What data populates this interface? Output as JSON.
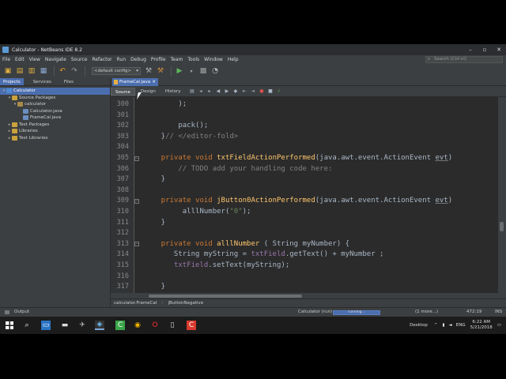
{
  "window": {
    "title": "Calculator - NetBeans IDE 8.2",
    "controls": [
      "–",
      "▫",
      "✕"
    ]
  },
  "menu": [
    "File",
    "Edit",
    "View",
    "Navigate",
    "Source",
    "Refactor",
    "Run",
    "Debug",
    "Profile",
    "Team",
    "Tools",
    "Window",
    "Help"
  ],
  "search": {
    "placeholder": "Search (Ctrl+I)"
  },
  "toolbar": {
    "config": "<default config>"
  },
  "left_panel": {
    "tabs": [
      "Projects",
      "Services",
      "Files"
    ],
    "active_tab": 0,
    "tree": [
      {
        "label": "Calculator",
        "depth": 0,
        "arrow": "▾",
        "icon": "proj",
        "selected": true
      },
      {
        "label": "Source Packages",
        "depth": 1,
        "arrow": "▾",
        "icon": "folder",
        "selected": false
      },
      {
        "label": "calculator",
        "depth": 2,
        "arrow": "▾",
        "icon": "pkg",
        "selected": false
      },
      {
        "label": "Calculator.java",
        "depth": 3,
        "arrow": "",
        "icon": "java",
        "selected": false
      },
      {
        "label": "FrameCal.java",
        "depth": 3,
        "arrow": "",
        "icon": "java",
        "selected": false
      },
      {
        "label": "Test Packages",
        "depth": 1,
        "arrow": "▸",
        "icon": "folder",
        "selected": false
      },
      {
        "label": "Libraries",
        "depth": 1,
        "arrow": "▸",
        "icon": "folder",
        "selected": false
      },
      {
        "label": "Test Libraries",
        "depth": 1,
        "arrow": "▸",
        "icon": "folder",
        "selected": false
      }
    ]
  },
  "editor": {
    "file_tab": "FrameCal.java",
    "view_tabs": [
      "Source",
      "Design",
      "History"
    ],
    "active_view": 0,
    "lines": [
      {
        "n": "300",
        "fold": "",
        "tokens": [
          {
            "t": "        );",
            "c": ""
          }
        ]
      },
      {
        "n": "301",
        "fold": "",
        "tokens": [
          {
            "t": "",
            "c": ""
          }
        ]
      },
      {
        "n": "302",
        "fold": "",
        "tokens": [
          {
            "t": "        pack();",
            "c": ""
          }
        ]
      },
      {
        "n": "303",
        "fold": "",
        "tokens": [
          {
            "t": "    }",
            "c": ""
          },
          {
            "t": "// </editor-fold>",
            "c": "cm"
          }
        ]
      },
      {
        "n": "304",
        "fold": "",
        "tokens": [
          {
            "t": "",
            "c": ""
          }
        ]
      },
      {
        "n": "305",
        "fold": "−",
        "tokens": [
          {
            "t": "    private void ",
            "c": "kw"
          },
          {
            "t": "txtFieldActionPerformed",
            "c": "fn"
          },
          {
            "t": "(java.awt.event.ActionEvent ",
            "c": ""
          },
          {
            "t": "evt",
            "c": "prm"
          },
          {
            "t": ")",
            "c": ""
          }
        ]
      },
      {
        "n": "306",
        "fold": "",
        "tokens": [
          {
            "t": "        // TODO add your handling code here:",
            "c": "cm"
          }
        ]
      },
      {
        "n": "307",
        "fold": "",
        "tokens": [
          {
            "t": "    }",
            "c": ""
          }
        ]
      },
      {
        "n": "308",
        "fold": "",
        "tokens": [
          {
            "t": "",
            "c": ""
          }
        ]
      },
      {
        "n": "309",
        "fold": "−",
        "tokens": [
          {
            "t": "    private void ",
            "c": "kw"
          },
          {
            "t": "jButton0ActionPerformed",
            "c": "fn"
          },
          {
            "t": "(java.awt.event.ActionEvent ",
            "c": ""
          },
          {
            "t": "evt",
            "c": "prm"
          },
          {
            "t": ")",
            "c": ""
          }
        ]
      },
      {
        "n": "310",
        "fold": "",
        "tokens": [
          {
            "t": "         alllNumber(",
            "c": ""
          },
          {
            "t": "\"0\"",
            "c": "str"
          },
          {
            "t": ");",
            "c": ""
          }
        ]
      },
      {
        "n": "311",
        "fold": "",
        "tokens": [
          {
            "t": "    }",
            "c": ""
          }
        ]
      },
      {
        "n": "312",
        "fold": "",
        "tokens": [
          {
            "t": "",
            "c": ""
          }
        ]
      },
      {
        "n": "313",
        "fold": "−",
        "tokens": [
          {
            "t": "    private void ",
            "c": "kw"
          },
          {
            "t": "alllNumber",
            "c": "fn"
          },
          {
            "t": " ( String myNumber) {",
            "c": ""
          }
        ]
      },
      {
        "n": "314",
        "fold": "",
        "tokens": [
          {
            "t": "       String myString = ",
            "c": ""
          },
          {
            "t": "txtField",
            "c": "fld"
          },
          {
            "t": ".getText() + myNumber ;",
            "c": ""
          }
        ]
      },
      {
        "n": "315",
        "fold": "",
        "tokens": [
          {
            "t": "       ",
            "c": ""
          },
          {
            "t": "txtField",
            "c": "fld"
          },
          {
            "t": ".setText(myString);",
            "c": ""
          }
        ]
      },
      {
        "n": "316",
        "fold": "",
        "tokens": [
          {
            "t": "",
            "c": ""
          }
        ]
      },
      {
        "n": "317",
        "fold": "",
        "tokens": [
          {
            "t": "    }",
            "c": ""
          }
        ]
      }
    ]
  },
  "breadcrumb": [
    "calculator.FrameCal",
    "jButtonNegative"
  ],
  "status": {
    "output": "Output",
    "task": "Calculator (run)",
    "progress": "running...",
    "more": "(1 more...)",
    "position": "472:19",
    "mode": "INS"
  },
  "taskbar": {
    "tray_label": "Desktop",
    "lang": "ENG",
    "time": "6:22 AM",
    "date": "5/21/2018"
  },
  "colors": {
    "accent": "#4b6eaf",
    "keyword": "#cc7832",
    "method": "#ffc66d",
    "comment": "#808080"
  }
}
